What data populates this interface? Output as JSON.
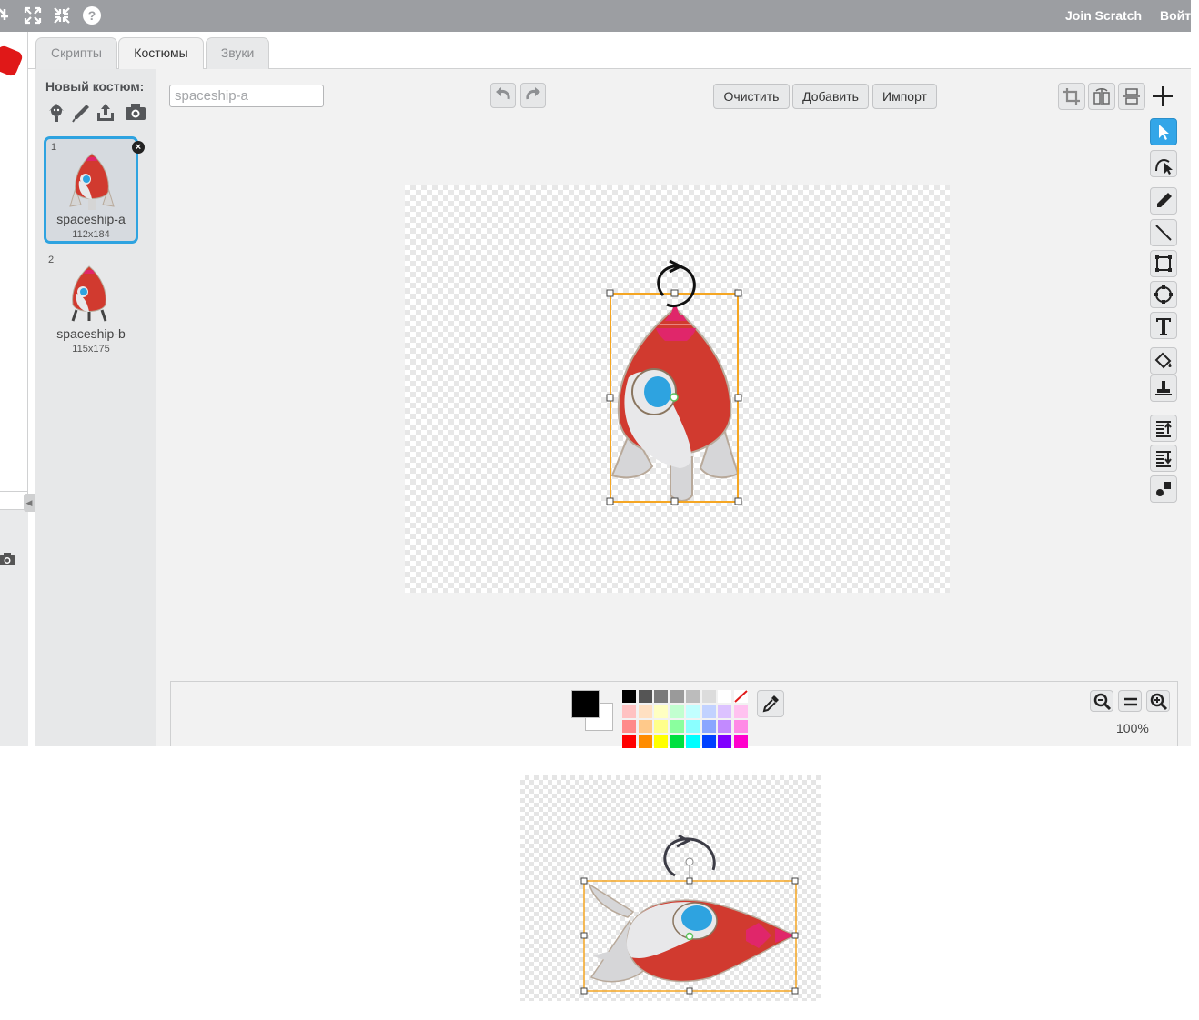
{
  "topbar": {
    "icons": [
      "duplicate-icon",
      "grow-icon",
      "shrink-icon",
      "help-icon"
    ],
    "join_label": "Join Scratch",
    "signin_label": "Войт"
  },
  "tabs": [
    {
      "label": "Скрипты",
      "active": false
    },
    {
      "label": "Костюмы",
      "active": true
    },
    {
      "label": "Звуки",
      "active": false
    }
  ],
  "costumes_panel": {
    "title": "Новый костюм:",
    "new_icons": [
      "choose-from-library-icon",
      "paint-new-icon",
      "upload-icon",
      "camera-icon"
    ],
    "items": [
      {
        "index": "1",
        "name": "spaceship-a",
        "size": "112x184",
        "selected": true
      },
      {
        "index": "2",
        "name": "spaceship-b",
        "size": "115x175",
        "selected": false
      }
    ]
  },
  "editor": {
    "costume_name": "spaceship-a",
    "clear_label": "Очистить",
    "add_label": "Добавить",
    "import_label": "Импорт",
    "zoom_label": "100%",
    "primary_color": "#000000",
    "secondary_color": "#ffffff",
    "tools": [
      "select-tool",
      "reshape-tool",
      "pencil-tool",
      "line-tool",
      "rectangle-tool",
      "ellipse-tool",
      "text-tool",
      "fill-tool",
      "stamp-tool",
      "forward-layer-tool",
      "backward-layer-tool",
      "ungroup-tool"
    ],
    "palette": [
      [
        "#000000",
        "#555555",
        "#7a7a7a",
        "#9a9a9a",
        "#bcbcbc",
        "#dcdcdc",
        "#ffffff",
        "none"
      ],
      [
        "#ffc2c2",
        "#ffe0c2",
        "#ffffc2",
        "#c2ffd0",
        "#c2ffff",
        "#c2d2ff",
        "#dcc2ff",
        "#ffc2f0"
      ],
      [
        "#ff8a8a",
        "#ffc98a",
        "#ffff8a",
        "#8aff9e",
        "#8affff",
        "#8aa6ff",
        "#c28aff",
        "#ff8ae6"
      ],
      [
        "#ff0000",
        "#ff8c00",
        "#ffff00",
        "#00e040",
        "#00ffff",
        "#0040ff",
        "#8000ff",
        "#ff00cc"
      ]
    ]
  },
  "colors": {
    "topbar": "#9c9ea2",
    "accent_blue": "#2ea3e0",
    "selection_orange": "#f5a623",
    "rocket_red": "#d13a2f"
  }
}
